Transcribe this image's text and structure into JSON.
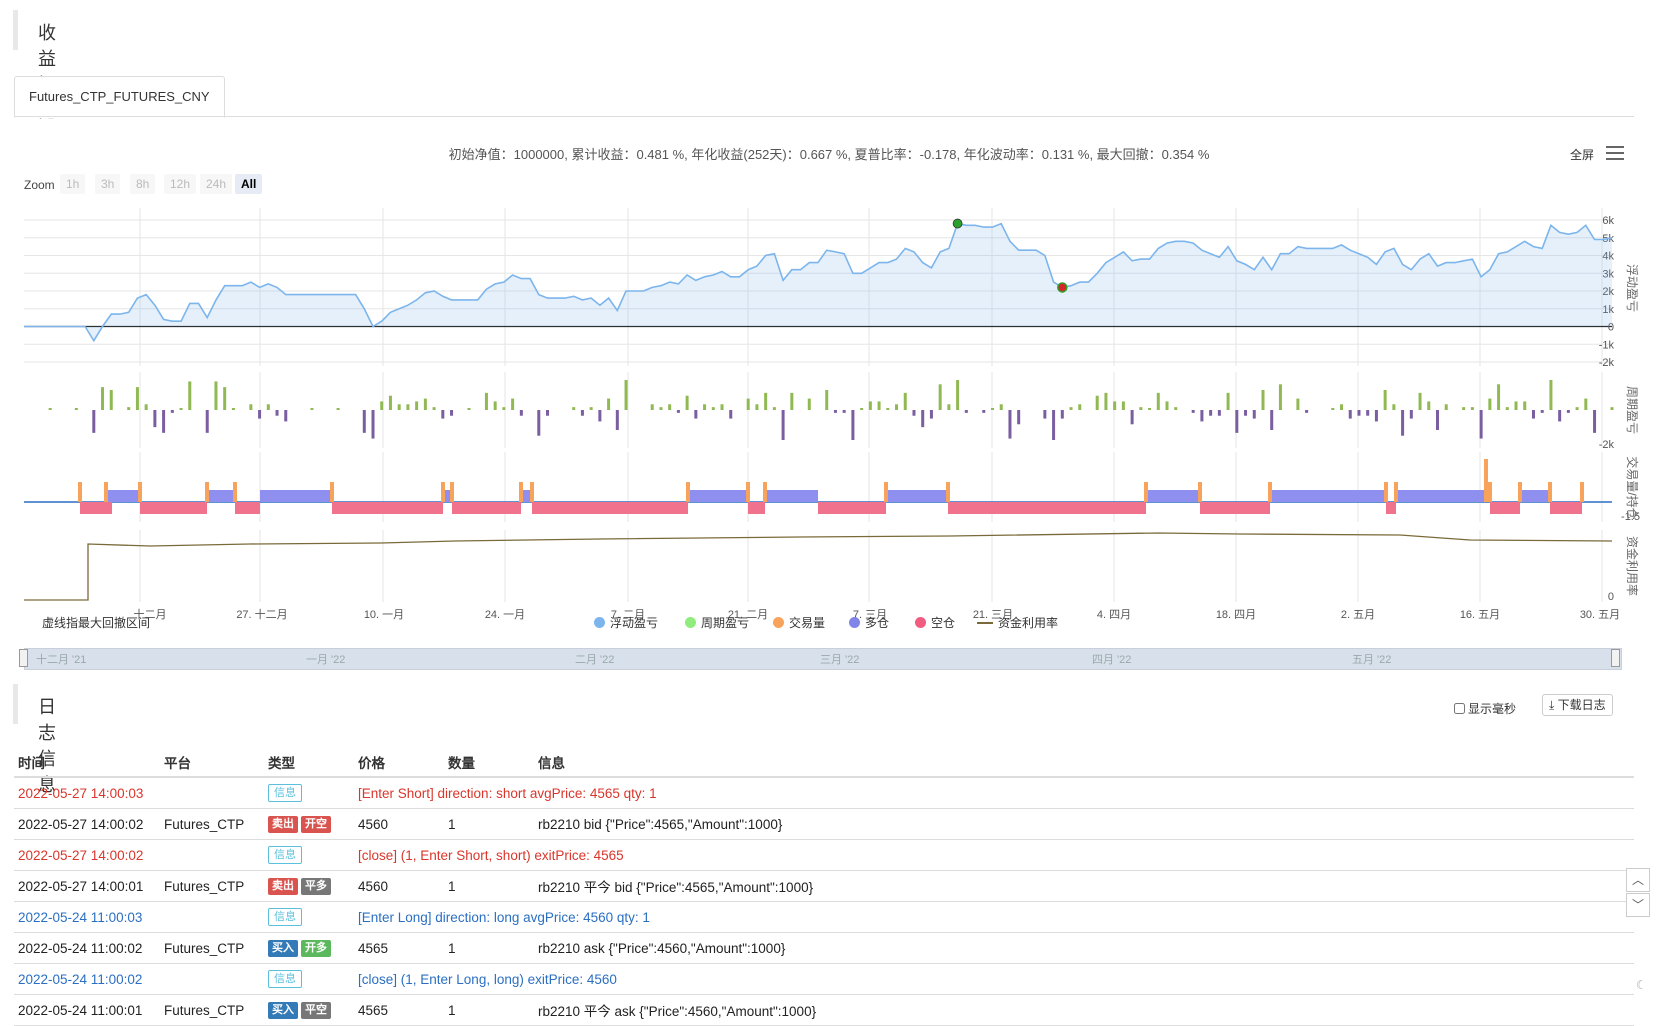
{
  "overview": {
    "title": "收益概览"
  },
  "tab": {
    "label": "Futures_CTP_FUTURES_CNY"
  },
  "summary": "初始净值：1000000, 累计收益：0.481 %, 年化收益(252天)：0.667 %, 夏普比率：-0.178, 年化波动率：0.131 %, 最大回撤：0.354 %",
  "toolbar": {
    "fullscreen": "全屏",
    "menu_icon": "hamburger-menu-icon"
  },
  "zoom": {
    "label": "Zoom",
    "buttons": [
      "1h",
      "3h",
      "8h",
      "12h",
      "24h",
      "All"
    ],
    "active": "All"
  },
  "chart_note": "虚线指最大回撤区间",
  "colors": {
    "floating": "#7cb5ec",
    "period_pos": "#90b953",
    "period_neg": "#7a5ea0",
    "volume": "#f7a35c",
    "long": "#8f8ff0",
    "short": "#f0728d",
    "util": "#7a6a3a"
  },
  "chart_data": {
    "type": "line",
    "panels": [
      {
        "name": "浮动盈亏",
        "y_ticks": [
          "6k",
          "5k",
          "4k",
          "3k",
          "2k",
          "1k",
          "0",
          "-1k",
          "-2k"
        ],
        "ylim": [
          -2000,
          6000
        ]
      },
      {
        "name": "周期盈亏",
        "y_ticks": [
          "-2k"
        ]
      },
      {
        "name": "交易量/持仓",
        "y_ticks": [
          "-1.5"
        ]
      },
      {
        "name": "资金利用率",
        "y_ticks": [
          "0"
        ]
      }
    ],
    "x_ticks": [
      "十二月",
      "27. 十二月",
      "10. 一月",
      "24. 一月",
      "7. 二月",
      "21. 二月",
      "7. 三月",
      "21. 三月",
      "4. 四月",
      "18. 四月",
      "2. 五月",
      "16. 五月",
      "30. 五月"
    ],
    "series": [
      {
        "name": "浮动盈亏",
        "values": [
          0,
          0,
          0,
          0,
          0,
          0,
          0,
          0,
          -800,
          0,
          700,
          700,
          800,
          1600,
          1800,
          1200,
          400,
          300,
          300,
          1300,
          1300,
          500,
          1500,
          2300,
          2300,
          2300,
          2500,
          2200,
          2400,
          2200,
          1800,
          1800,
          1800,
          1800,
          1800,
          1800,
          1800,
          1800,
          1800,
          1000,
          0,
          300,
          800,
          1000,
          1200,
          1500,
          1900,
          2000,
          1700,
          1500,
          1500,
          1500,
          1500,
          2100,
          2400,
          2500,
          2900,
          2700,
          2700,
          1800,
          1600,
          1600,
          1600,
          1700,
          1500,
          1600,
          1200,
          1600,
          900,
          2000,
          2000,
          2000,
          2200,
          2300,
          2500,
          2400,
          2900,
          2600,
          2800,
          2900,
          3100,
          2800,
          2800,
          3200,
          3400,
          4000,
          4100,
          2600,
          3200,
          3200,
          3600,
          3600,
          4300,
          4200,
          4100,
          3000,
          3000,
          3300,
          3600,
          3600,
          3800,
          4400,
          4200,
          3600,
          3300,
          4200,
          4400,
          5800,
          5700,
          5700,
          5600,
          5600,
          5800,
          4800,
          4300,
          4300,
          4300,
          4000,
          2500,
          2200,
          2300,
          2500,
          2500,
          3000,
          3600,
          3900,
          4200,
          3700,
          3800,
          3800,
          4400,
          4700,
          4800,
          4800,
          4700,
          4300,
          4100,
          3900,
          4500,
          3700,
          3500,
          3200,
          3900,
          3200,
          4100,
          4100,
          4500,
          4400,
          4400,
          4400,
          4400,
          4600,
          4300,
          4100,
          3900,
          3500,
          4200,
          4400,
          3500,
          3200,
          3800,
          4100,
          3400,
          3600,
          3600,
          3700,
          3800,
          2800,
          3200,
          4100,
          4200,
          4500,
          4800,
          4500,
          4400,
          5700,
          5300,
          5200,
          5300,
          5700,
          4900,
          4900,
          5000
        ]
      },
      {
        "name": "周期盈亏"
      },
      {
        "name": "交易量"
      },
      {
        "name": "多仓"
      },
      {
        "name": "空仓"
      },
      {
        "name": "资金利用率"
      }
    ],
    "markers": [
      {
        "label": "peak",
        "color": "#2ca02c"
      },
      {
        "label": "trough",
        "color": "#d62728"
      }
    ],
    "legend_position": "bottom"
  },
  "navigator": {
    "labels": [
      "十二月 '21",
      "一月 '22",
      "二月 '22",
      "三月 '22",
      "四月 '22",
      "五月 '22"
    ]
  },
  "log": {
    "title": "日志信息",
    "show_ms": "显示毫秒",
    "download": "下载日志",
    "headers": {
      "time": "时间",
      "platform": "平台",
      "type": "类型",
      "price": "价格",
      "qty": "数量",
      "info": "信息"
    },
    "rows": [
      {
        "time": "2022-05-27 14:00:03",
        "platform": "",
        "b1": "信息",
        "price": "[Enter Short] direction: short avgPrice: 4565 qty: 1",
        "qty": "",
        "info": ""
      },
      {
        "time": "2022-05-27 14:00:02",
        "platform": "Futures_CTP",
        "b1": "卖出",
        "b2": "开空",
        "price": "4560",
        "qty": "1",
        "info": "rb2210 bid {\"Price\":4565,\"Amount\":1000}"
      },
      {
        "time": "2022-05-27 14:00:02",
        "platform": "",
        "b1": "信息",
        "price": "[close] (1, Enter Short, short) exitPrice: 4565",
        "qty": "",
        "info": ""
      },
      {
        "time": "2022-05-27 14:00:01",
        "platform": "Futures_CTP",
        "b1": "卖出",
        "b2": "平多",
        "price": "4560",
        "qty": "1",
        "info": "rb2210 平今 bid {\"Price\":4565,\"Amount\":1000}"
      },
      {
        "time": "2022-05-24 11:00:03",
        "platform": "",
        "b1": "信息",
        "price": "[Enter Long] direction: long avgPrice: 4560 qty: 1",
        "qty": "",
        "info": ""
      },
      {
        "time": "2022-05-24 11:00:02",
        "platform": "Futures_CTP",
        "b1": "买入",
        "b2": "开多",
        "price": "4565",
        "qty": "1",
        "info": "rb2210 ask {\"Price\":4560,\"Amount\":1000}"
      },
      {
        "time": "2022-05-24 11:00:02",
        "platform": "",
        "b1": "信息",
        "price": "[close] (1, Enter Long, long) exitPrice: 4560",
        "qty": "",
        "info": ""
      },
      {
        "time": "2022-05-24 11:00:01",
        "platform": "Futures_CTP",
        "b1": "买入",
        "b2": "平空",
        "price": "4565",
        "qty": "1",
        "info": "rb2210 平今 ask {\"Price\":4560,\"Amount\":1000}"
      }
    ]
  }
}
